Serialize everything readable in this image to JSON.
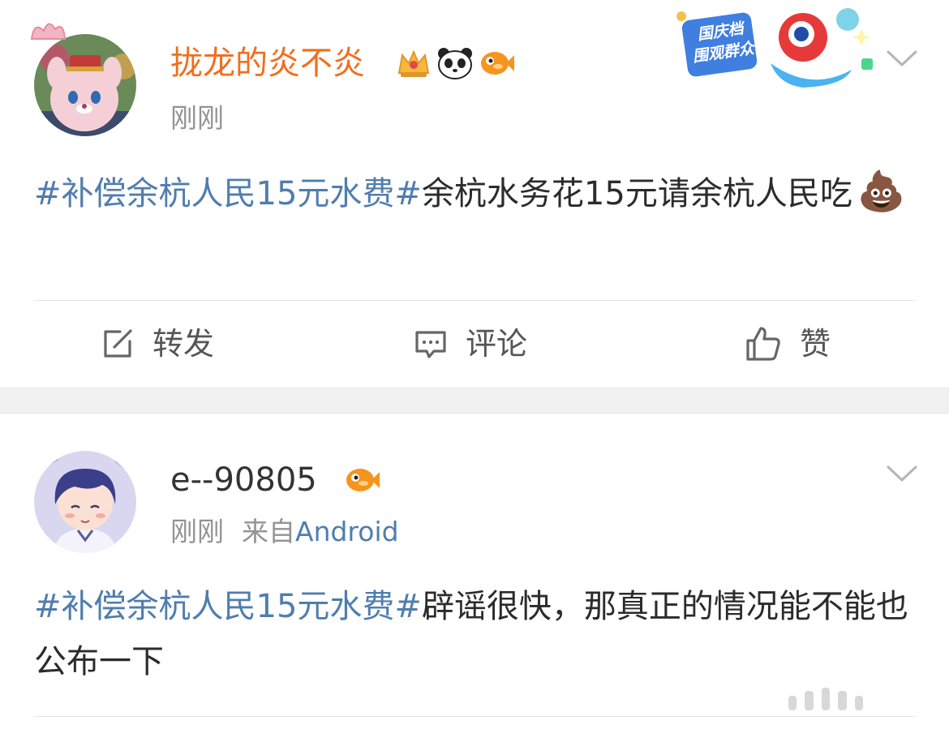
{
  "posts": [
    {
      "username": "拢龙的炎不炎",
      "badges": [
        "crown-badge",
        "panda-badge",
        "fish-badge"
      ],
      "time": "刚刚",
      "source_prefix": "",
      "source": "",
      "content_topic": "#补偿余杭人民15元水费#",
      "content_text": "余杭水务花15元请余杭人民吃",
      "content_emoji": "💩",
      "banner_text": "国庆档 围观群众",
      "actions": {
        "repost": "转发",
        "comment": "评论",
        "like": "赞"
      }
    },
    {
      "username": "e--90805",
      "badges": [
        "fish-badge"
      ],
      "time": "刚刚",
      "source_prefix": "来自",
      "source": "Android",
      "content_topic": "#补偿余杭人民15元水费#",
      "content_text": "辟谣很快，那真正的情况能不能也公布一下"
    }
  ],
  "colors": {
    "username_vip": "#f26d1d",
    "topic": "#507daf",
    "meta": "#939393",
    "text": "#2b2b2b",
    "divider": "#f1f1f1"
  }
}
